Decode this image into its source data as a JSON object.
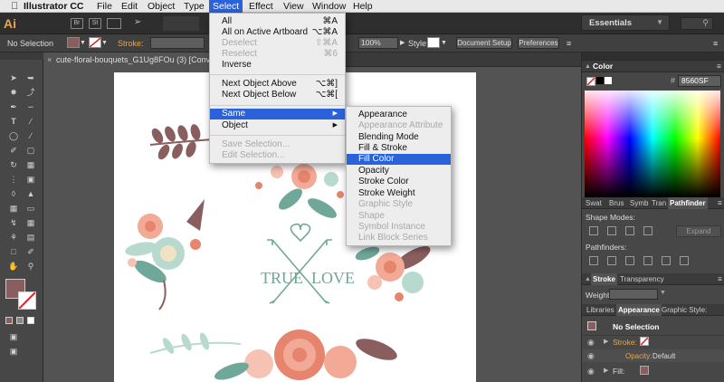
{
  "menubar": {
    "apple_icon": "apple-icon",
    "items": [
      "Illustrator CC",
      "File",
      "Edit",
      "Object",
      "Type",
      "Select",
      "Effect",
      "View",
      "Window",
      "Help"
    ]
  },
  "appbar": {
    "logo": "Ai",
    "br": "Br",
    "st": "St",
    "workspace": "Essentials"
  },
  "control": {
    "selection": "No Selection",
    "stroke_label": "Stroke:",
    "opacity_value": "100%",
    "style_label": "Style:",
    "doc_setup": "Document Setup",
    "preferences": "Preferences"
  },
  "document": {
    "tab": "cute-floral-bouquets_G1Ug8FOu (3) [Converted]..."
  },
  "select_menu": {
    "items": [
      {
        "label": "All",
        "shortcut": "⌘A",
        "disabled": false
      },
      {
        "label": "All on Active Artboard",
        "shortcut": "⌥⌘A",
        "disabled": false
      },
      {
        "label": "Deselect",
        "shortcut": "⇧⌘A",
        "disabled": true
      },
      {
        "label": "Reselect",
        "shortcut": "⌘6",
        "disabled": true
      },
      {
        "label": "Inverse",
        "shortcut": "",
        "disabled": false
      },
      {
        "label": "Next Object Above",
        "shortcut": "⌥⌘]",
        "disabled": false
      },
      {
        "label": "Next Object Below",
        "shortcut": "⌥⌘[",
        "disabled": false
      },
      {
        "label": "Same",
        "shortcut": "▶",
        "disabled": false
      },
      {
        "label": "Object",
        "shortcut": "▶",
        "disabled": false
      },
      {
        "label": "Save Selection...",
        "shortcut": "",
        "disabled": true
      },
      {
        "label": "Edit Selection...",
        "shortcut": "",
        "disabled": true
      }
    ]
  },
  "same_menu": {
    "items": [
      {
        "label": "Appearance",
        "disabled": false
      },
      {
        "label": "Appearance Attribute",
        "disabled": true
      },
      {
        "label": "Blending Mode",
        "disabled": false
      },
      {
        "label": "Fill & Stroke",
        "disabled": false
      },
      {
        "label": "Fill Color",
        "disabled": false
      },
      {
        "label": "Opacity",
        "disabled": false
      },
      {
        "label": "Stroke Color",
        "disabled": false
      },
      {
        "label": "Stroke Weight",
        "disabled": false
      },
      {
        "label": "Graphic Style",
        "disabled": true
      },
      {
        "label": "Shape",
        "disabled": true
      },
      {
        "label": "Symbol Instance",
        "disabled": true
      },
      {
        "label": "Link Block Series",
        "disabled": true
      }
    ]
  },
  "artwork": {
    "text_left": "TRUE",
    "text_right": "LOVE"
  },
  "color_panel": {
    "title": "Color",
    "hex": "8560SF"
  },
  "path_panel": {
    "tabs": [
      "Swat",
      "Brus",
      "Symb",
      "Tran",
      "Pathfinder"
    ],
    "shape_modes": "Shape Modes:",
    "expand": "Expand",
    "pathfinders": "Pathfinders:"
  },
  "stroke_panel": {
    "tabs": [
      "Stroke",
      "Transparency"
    ],
    "weight_label": "Weight:"
  },
  "appearance_panel": {
    "tabs": [
      "Libraries",
      "Appearance",
      "Graphic Style:"
    ],
    "no_selection": "No Selection",
    "stroke_label": "Stroke:",
    "opacity_label": "Opacity:",
    "opacity_value": "Default",
    "fill_label": "Fill:"
  },
  "colors": {
    "accent": "#2a62d9",
    "fill_swatch": "#8a5e5f",
    "essentials_bg": "#2e2e2e"
  }
}
